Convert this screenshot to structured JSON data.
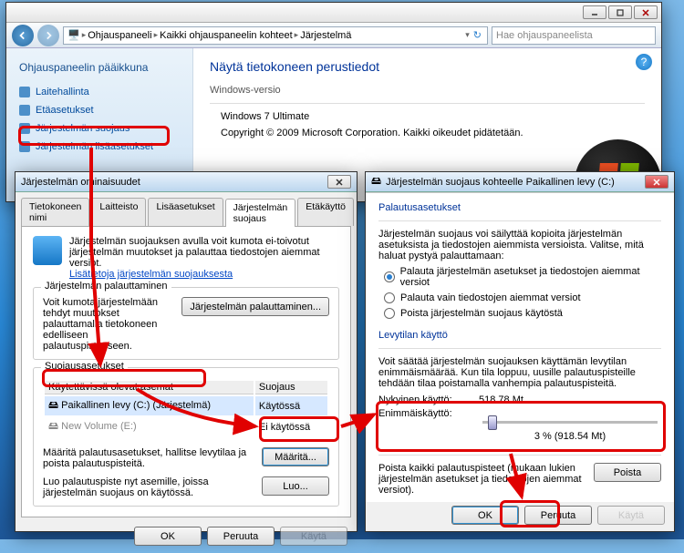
{
  "cp": {
    "crumbs": [
      "Ohjauspaneeli",
      "Kaikki ohjauspaneelin kohteet",
      "Järjestelmä"
    ],
    "search_placeholder": "Hae ohjauspaneelista",
    "side_title": "Ohjauspaneelin pääikkuna",
    "side_links": [
      "Laitehallinta",
      "Etäasetukset",
      "Järjestelmän suojaus",
      "Järjestelmän lisäasetukset"
    ],
    "main_heading": "Näytä tietokoneen perustiedot",
    "edition_label": "Windows-versio",
    "edition_value": "Windows 7 Ultimate",
    "copyright": "Copyright © 2009 Microsoft Corporation. Kaikki oikeudet pidätetään."
  },
  "props": {
    "title": "Järjestelmän ominaisuudet",
    "tabs": [
      "Tietokoneen nimi",
      "Laitteisto",
      "Lisäasetukset",
      "Järjestelmän suojaus",
      "Etäkäyttö"
    ],
    "active_tab": 3,
    "desc": "Järjestelmän suojauksen avulla voit kumota ei-toivotut järjestelmän muutokset ja palauttaa tiedostojen aiemmat versiot.",
    "more_link": "Lisätietoja järjestelmän suojauksesta",
    "restore_group": "Järjestelmän palauttaminen",
    "restore_text": "Voit kumota järjestelmään tehdyt muutokset palauttamalla tietokoneen edelliseen palautuspisteeseen.",
    "restore_btn": "Järjestelmän palauttaminen...",
    "settings_group": "Suojausasetukset",
    "col_drives": "Käytettävissä olevat asemat",
    "col_prot": "Suojaus",
    "drives": [
      {
        "name": "Paikallinen levy (C:) (Järjestelmä)",
        "prot": "Käytössä"
      },
      {
        "name": "New Volume (E:)",
        "prot": "Ei käytössä"
      }
    ],
    "configure_text": "Määritä palautusasetukset, hallitse levytilaa ja poista palautuspisteitä.",
    "configure_btn": "Määritä...",
    "create_text": "Luo palautuspiste nyt asemille, joissa järjestelmän suojaus on käytössä.",
    "create_btn": "Luo...",
    "ok": "OK",
    "cancel": "Peruuta",
    "apply": "Käytä"
  },
  "prot": {
    "title": "Järjestelmän suojaus kohteelle Paikallinen levy (C:)",
    "settings_group": "Palautusasetukset",
    "settings_desc": "Järjestelmän suojaus voi säilyttää kopioita järjestelmän asetuksista ja tiedostojen aiemmista versioista. Valitse, mitä haluat pystyä palauttamaan:",
    "opt1": "Palauta järjestelmän asetukset ja tiedostojen aiemmat versiot",
    "opt2": "Palauta vain tiedostojen aiemmat versiot",
    "opt3": "Poista järjestelmän suojaus käytöstä",
    "disk_group": "Levytilan käyttö",
    "disk_desc": "Voit säätää järjestelmän suojauksen käyttämän levytilan enimmäismäärää. Kun tila loppuu, uusille palautuspisteille tehdään tilaa poistamalla vanhempia palautuspisteitä.",
    "current_label": "Nykyinen käyttö:",
    "current_value": "518.78 Mt",
    "max_label": "Enimmäiskäyttö:",
    "max_value": "3 % (918.54 Mt)",
    "delete_text": "Poista kaikki palautuspisteet (mukaan lukien järjestelmän asetukset ja tiedostojen aiemmat versiot).",
    "delete_btn": "Poista",
    "ok": "OK",
    "cancel": "Peruuta",
    "apply": "Käytä"
  }
}
